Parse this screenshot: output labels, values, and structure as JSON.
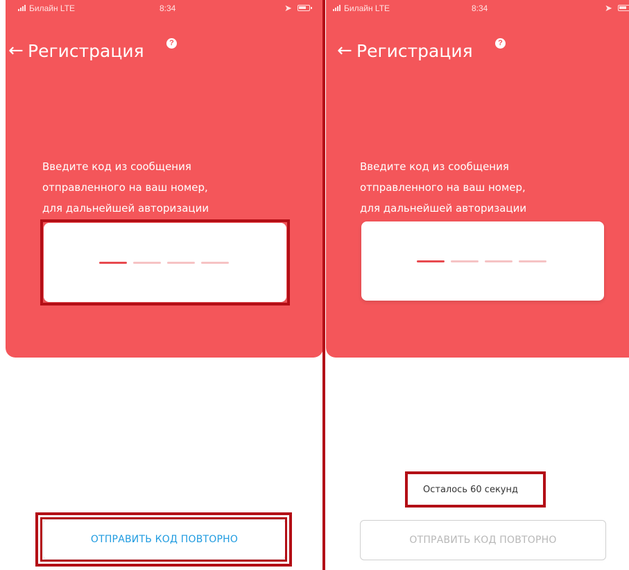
{
  "screens": [
    {
      "status_bar": {
        "carrier": "Билайн LTE",
        "time": "8:34"
      },
      "header": {
        "title": "Регистрация",
        "help": "?"
      },
      "instruction": [
        "Введите код из сообщения",
        "отправленного на ваш номер,",
        "для дальнейшей авторизации"
      ],
      "resend_button": {
        "label": "ОТПРАВИТЬ КОД ПОВТОРНО",
        "state": "enabled"
      }
    },
    {
      "status_bar": {
        "carrier": "Билайн LTE",
        "time": "8:34"
      },
      "header": {
        "title": "Регистрация",
        "help": "?"
      },
      "instruction": [
        "Введите код из сообщения",
        "отправленного на ваш номер,",
        "для дальнейшей авторизации"
      ],
      "timer": {
        "text": "Осталось 60 секунд"
      },
      "resend_button": {
        "label": "ОТПРАВИТЬ КОД ПОВТОРНО",
        "state": "disabled"
      }
    }
  ],
  "colors": {
    "header_red": "#f4565a",
    "highlight_red": "#b30e16",
    "link_blue": "#1f9be0",
    "disabled_gray": "#b8b8b8"
  },
  "icons": {
    "back": "arrow-left-icon",
    "help": "question-circle-icon",
    "signal": "signal-bars-icon",
    "location": "location-arrow-icon",
    "battery": "battery-icon"
  }
}
